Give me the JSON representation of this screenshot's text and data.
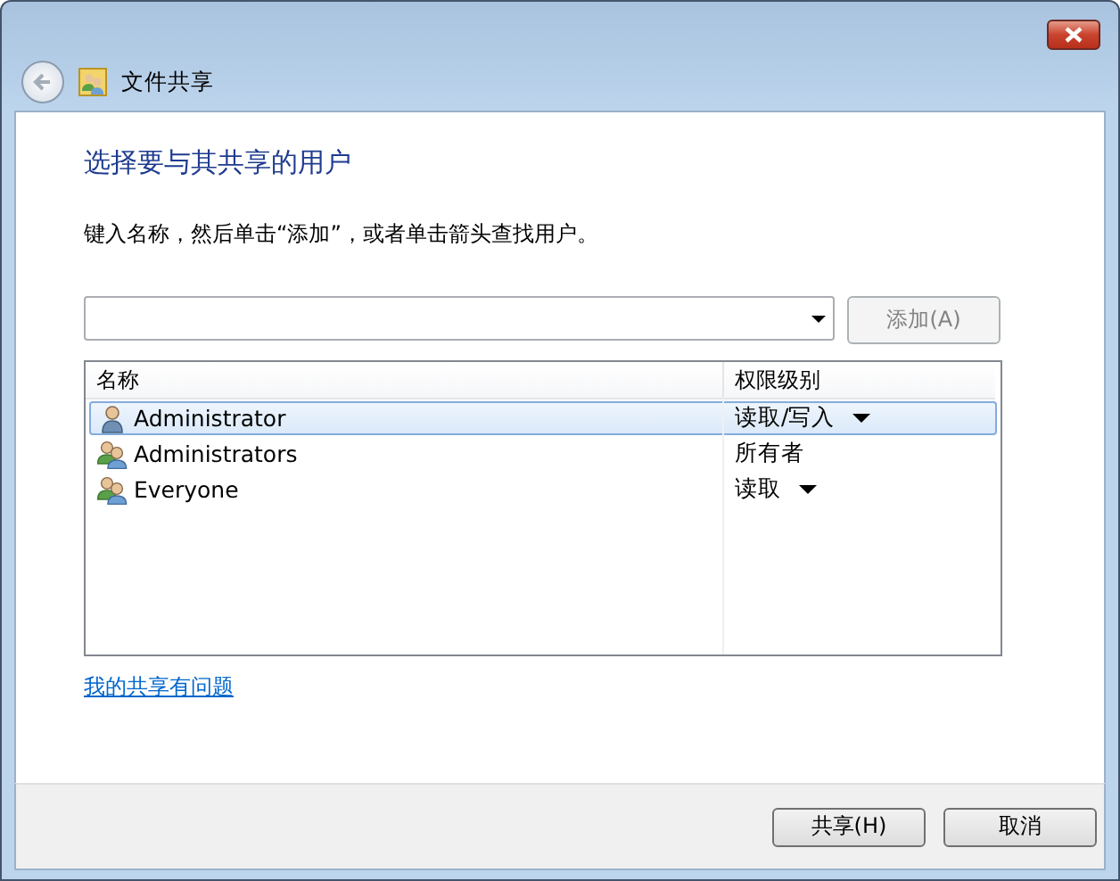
{
  "window": {
    "title": "文件共享"
  },
  "heading": "选择要与其共享的用户",
  "instruction": "键入名称，然后单击“添加”，或者单击箭头查找用户。",
  "add_button": {
    "label": "添加(A)",
    "disabled": true
  },
  "table": {
    "columns": [
      "名称",
      "权限级别"
    ],
    "rows": [
      {
        "kind": "user",
        "name": "Administrator",
        "permission": "读取/写入",
        "dropdown": true,
        "selected": true
      },
      {
        "kind": "group",
        "name": "Administrators",
        "permission": "所有者",
        "dropdown": false,
        "selected": false
      },
      {
        "kind": "group",
        "name": "Everyone",
        "permission": "读取",
        "dropdown": true,
        "selected": false
      }
    ]
  },
  "help_link": "我的共享有问题",
  "buttons": [
    {
      "label": "共享(H)"
    },
    {
      "label": "取消"
    }
  ]
}
